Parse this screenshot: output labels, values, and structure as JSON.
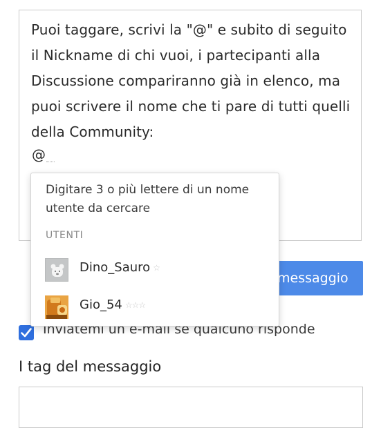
{
  "editor": {
    "body_text": "Puoi taggare, scrivi la \"@\" e subito di seguito il Nickname di chi vuoi, i partecipanti alla Discussione compariranno già in elenco, ma puoi scrivere il nome che ti pare di tutti quelli della Community:",
    "mention_prefix": "@"
  },
  "post_button": {
    "label": "messaggio"
  },
  "email_option": {
    "label": "Inviatemi un e-mail se qualcuno risponde",
    "checked": true
  },
  "tags": {
    "heading": "I tag del messaggio",
    "value": ""
  },
  "mention_popup": {
    "hint": "Digitare 3 o più lettere di un nome utente da cercare",
    "section_label": "UTENTI",
    "users": [
      {
        "name": "Dino_Sauro",
        "stars": "☆",
        "avatar": "bear-avatar-icon"
      },
      {
        "name": "Gio_54",
        "stars": "☆☆☆",
        "avatar": "cartoon-avatar-icon"
      }
    ]
  },
  "colors": {
    "accent": "#4d8ae8",
    "checkbox": "#2f6fde",
    "border": "#c9c9c9"
  }
}
